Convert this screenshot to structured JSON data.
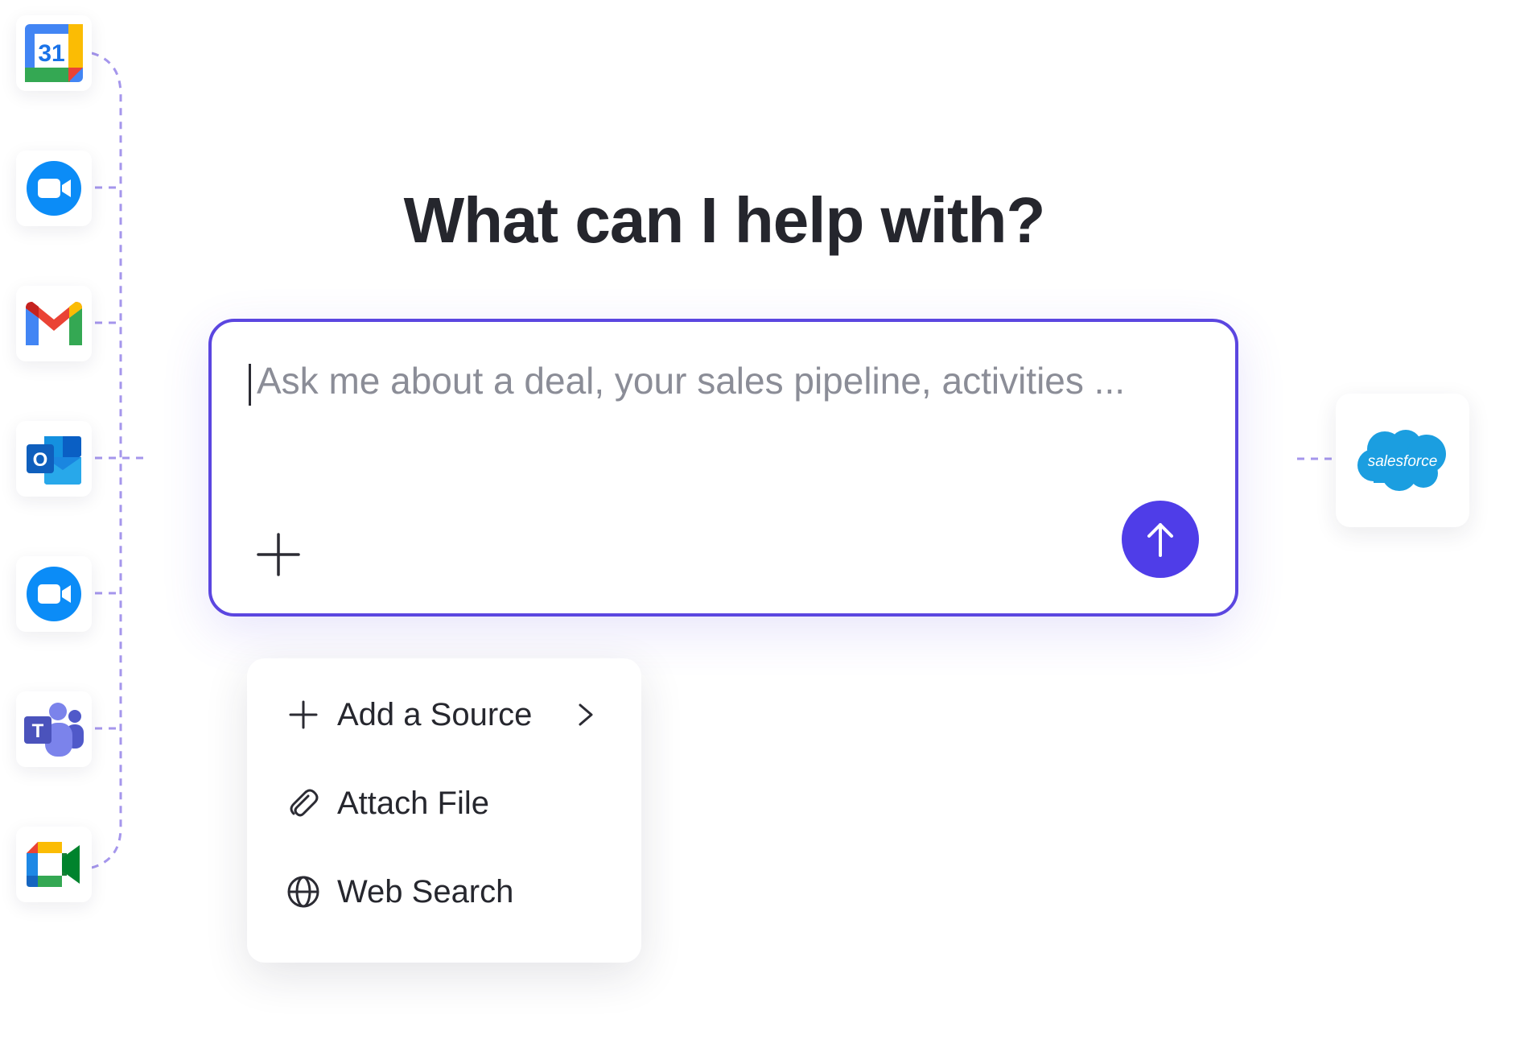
{
  "heading": "What can I help with?",
  "prompt": {
    "placeholder": "Ask me about a deal, your sales pipeline, activities ..."
  },
  "integrations": [
    {
      "name": "google-calendar",
      "label": "31"
    },
    {
      "name": "zoom"
    },
    {
      "name": "gmail"
    },
    {
      "name": "outlook",
      "label": "O"
    },
    {
      "name": "zoom"
    },
    {
      "name": "microsoft-teams",
      "label": "T"
    },
    {
      "name": "google-meet"
    }
  ],
  "target": {
    "name": "salesforce",
    "label": "salesforce"
  },
  "menu": {
    "items": [
      {
        "label": "Add a Source",
        "icon": "plus-icon",
        "has_submenu": true
      },
      {
        "label": "Attach File",
        "icon": "paperclip-icon"
      },
      {
        "label": "Web Search",
        "icon": "globe-icon"
      }
    ]
  },
  "colors": {
    "accent": "#4f3de8",
    "border": "#5b46e0",
    "connector": "#a596ec",
    "salesforce": "#1b9ee0"
  }
}
